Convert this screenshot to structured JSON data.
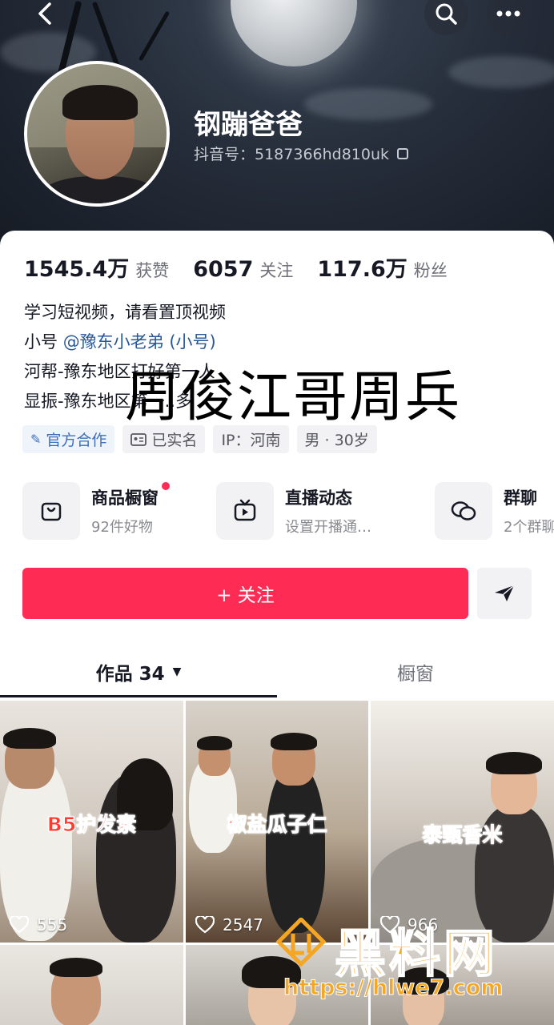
{
  "header": {
    "back_icon": "chevron-left-icon",
    "search_icon": "search-icon",
    "more_icon": "more-dots-icon"
  },
  "profile": {
    "nickname": "钢蹦爸爸",
    "douyin_id": "抖音号：5187366hd810uk"
  },
  "stats": [
    {
      "value": "1545.4万",
      "label": "获赞"
    },
    {
      "value": "6057",
      "label": "关注"
    },
    {
      "value": "117.6万",
      "label": "粉丝"
    }
  ],
  "bio": {
    "line1": "学习短视频，请看置顶视频",
    "line2_prefix": "小号 ",
    "line2_mention": "@豫东小老弟 (小号)",
    "line3": "河帮-豫东地区打好第一人",
    "line4": "显振-豫东地区第一..多"
  },
  "overlay_text": "周俊江哥周兵",
  "tags": [
    {
      "label": "官方合作",
      "icon": "cooperation-icon"
    },
    {
      "label": "已实名",
      "icon": "id-card-icon"
    },
    {
      "label": "IP：河南"
    },
    {
      "label": "男 · 30岁"
    }
  ],
  "services": [
    {
      "title": "商品橱窗",
      "subtitle": "92件好物",
      "icon": "shopping-bag-icon",
      "has_dot": true
    },
    {
      "title": "直播动态",
      "subtitle": "设置开播通…",
      "icon": "tv-icon"
    },
    {
      "title": "群聊",
      "subtitle": "2个群聊",
      "icon": "chat-bubbles-icon"
    }
  ],
  "actions": {
    "follow_label": "+ 关注",
    "share_icon": "send-icon"
  },
  "tabs": {
    "works": "作品 34",
    "works_caret": "▼",
    "shop": "橱窗"
  },
  "videos": [
    {
      "caption": "B5护发素",
      "likes": "555"
    },
    {
      "caption": "椒盐瓜子仁",
      "likes": "2547"
    },
    {
      "caption": "泰甄香米",
      "likes": "966"
    },
    {
      "caption": "",
      "likes": ""
    },
    {
      "caption": "",
      "likes": ""
    },
    {
      "caption": "",
      "likes": ""
    }
  ],
  "watermark": {
    "brand": "黑料网",
    "url": "https://hlwe7.com"
  },
  "colors": {
    "accent": "#fe2c55",
    "mention": "#2a5896",
    "watermark": "#f5a623"
  }
}
